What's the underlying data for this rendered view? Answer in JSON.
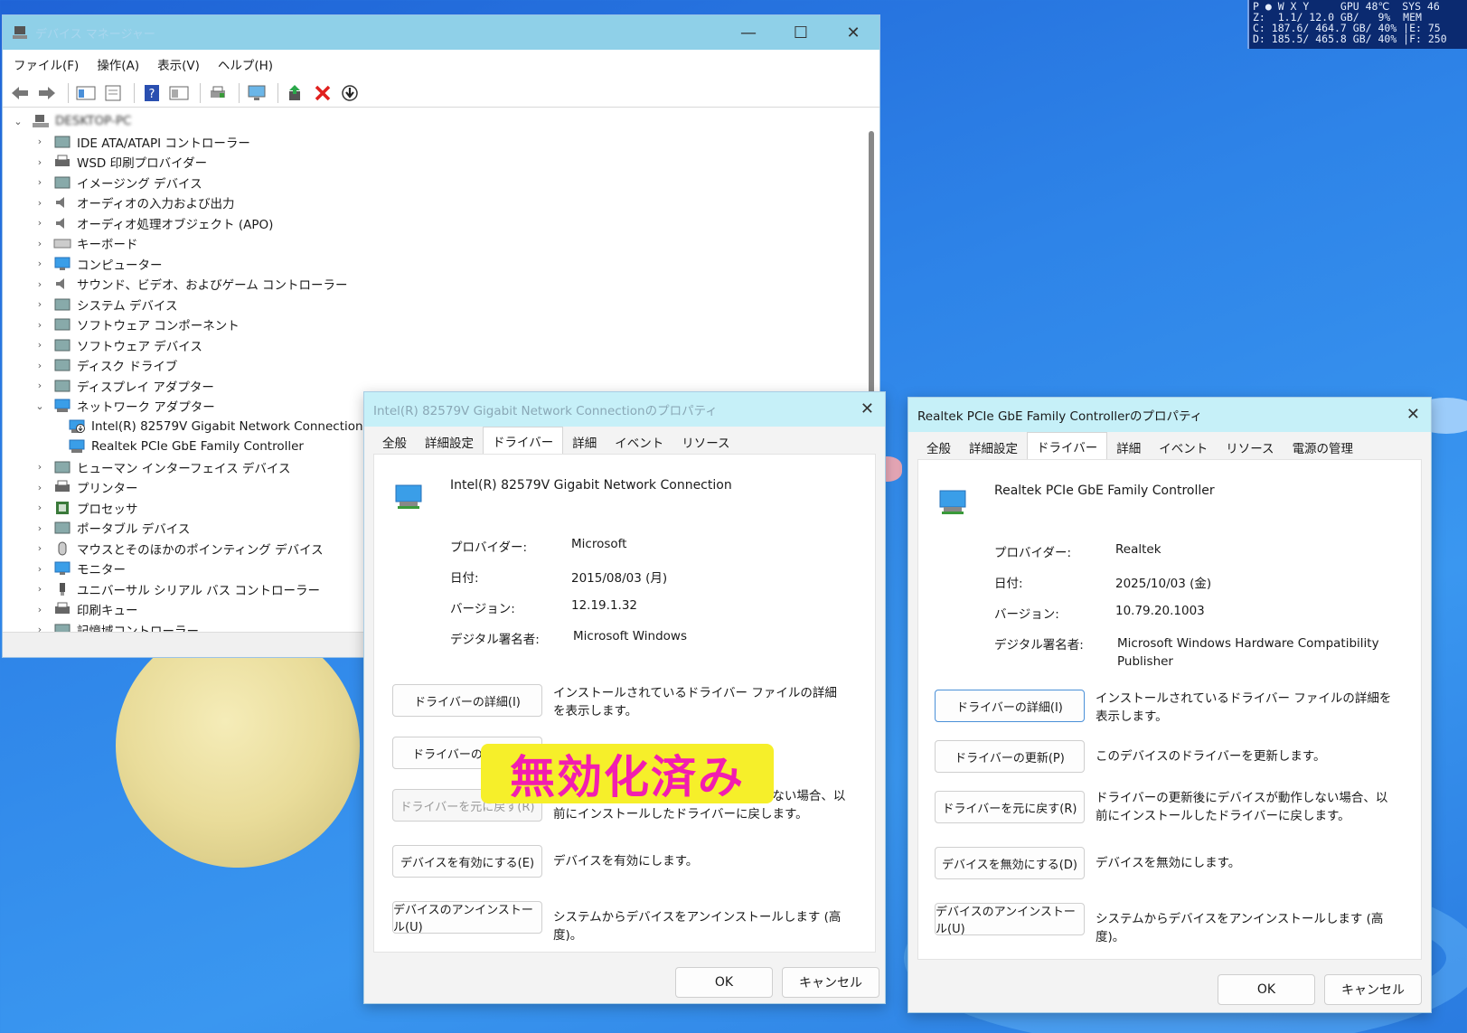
{
  "sysmon": {
    "line1": "P ● W X Y     GPU 48℃  SYS 46",
    "line2": "Z:  1.1/ 12.0 GB/   9%  MEM",
    "line3": "C: 187.6/ 464.7 GB/ 40% |E: 75",
    "line4": "D: 185.5/ 465.8 GB/ 40% |F: 250"
  },
  "device_manager": {
    "title": "デバイス マネージャー",
    "menu": [
      "ファイル(F)",
      "操作(A)",
      "表示(V)",
      "ヘルプ(H)"
    ],
    "root_label": "DESKTOP-PC",
    "categories": [
      {
        "label": "IDE ATA/ATAPI コントローラー",
        "icon": "ide-controller-icon"
      },
      {
        "label": "WSD 印刷プロバイダー",
        "icon": "printer-icon"
      },
      {
        "label": "イメージング デバイス",
        "icon": "camera-icon"
      },
      {
        "label": "オーディオの入力および出力",
        "icon": "speaker-icon"
      },
      {
        "label": "オーディオ処理オブジェクト (APO)",
        "icon": "speaker-icon"
      },
      {
        "label": "キーボード",
        "icon": "keyboard-icon"
      },
      {
        "label": "コンピューター",
        "icon": "monitor-icon"
      },
      {
        "label": "サウンド、ビデオ、およびゲーム コントローラー",
        "icon": "speaker-icon"
      },
      {
        "label": "システム デバイス",
        "icon": "folder-monitor-icon"
      },
      {
        "label": "ソフトウェア コンポーネント",
        "icon": "software-component-icon"
      },
      {
        "label": "ソフトウェア デバイス",
        "icon": "software-device-icon"
      },
      {
        "label": "ディスク ドライブ",
        "icon": "disk-drive-icon"
      },
      {
        "label": "ディスプレイ アダプター",
        "icon": "display-adapter-icon"
      },
      {
        "label": "ネットワーク アダプター",
        "icon": "network-adapter-icon"
      }
    ],
    "network_children": [
      {
        "label": "Intel(R) 82579V Gigabit Network Connection",
        "icon": "network-adapter-disabled-icon"
      },
      {
        "label": "Realtek PCIe GbE Family Controller",
        "icon": "network-adapter-icon"
      }
    ],
    "categories_after": [
      {
        "label": "ヒューマン インターフェイス デバイス",
        "icon": "hid-icon"
      },
      {
        "label": "プリンター",
        "icon": "printer-icon"
      },
      {
        "label": "プロセッサ",
        "icon": "processor-icon"
      },
      {
        "label": "ポータブル デバイス",
        "icon": "portable-device-icon"
      },
      {
        "label": "マウスとそのほかのポインティング デバイス",
        "icon": "mouse-icon"
      },
      {
        "label": "モニター",
        "icon": "monitor-icon"
      },
      {
        "label": "ユニバーサル シリアル バス コントローラー",
        "icon": "usb-icon"
      },
      {
        "label": "印刷キュー",
        "icon": "printer-icon"
      },
      {
        "label": "記憶域コントローラー",
        "icon": "storage-controller-icon"
      }
    ]
  },
  "intel_dialog": {
    "title": "Intel(R) 82579V Gigabit Network Connectionのプロパティ",
    "tabs": [
      "全般",
      "詳細設定",
      "ドライバー",
      "詳細",
      "イベント",
      "リソース"
    ],
    "device_name": "Intel(R) 82579V Gigabit Network Connection",
    "provider_label": "プロバイダー:",
    "provider": "Microsoft",
    "date_label": "日付:",
    "date": "2015/08/03 (月)",
    "version_label": "バージョン:",
    "version": "12.19.1.32",
    "signer_label": "デジタル署名者:",
    "signer": "Microsoft Windows",
    "btn_details": "ドライバーの詳細(I)",
    "desc_details": "インストールされているドライバー ファイルの詳細を表示します。",
    "btn_update": "ドライバーの更新(P)",
    "btn_rollback": "ドライバーを元に戻す(R)",
    "desc_rollback": "ドライバーの更新後にデバイスが動作しない場合、以前にインストールしたドライバーに戻します。",
    "btn_enable": "デバイスを有効にする(E)",
    "desc_enable": "デバイスを有効にします。",
    "btn_uninstall": "デバイスのアンインストール(U)",
    "desc_uninstall": "システムからデバイスをアンインストールします (高度)。",
    "ok": "OK",
    "cancel": "キャンセル"
  },
  "stamp_text": "無効化済み",
  "realtek_dialog": {
    "title": "Realtek PCIe GbE Family Controllerのプロパティ",
    "tabs": [
      "全般",
      "詳細設定",
      "ドライバー",
      "詳細",
      "イベント",
      "リソース",
      "電源の管理"
    ],
    "device_name": "Realtek PCIe GbE Family Controller",
    "provider_label": "プロバイダー:",
    "provider": "Realtek",
    "date_label": "日付:",
    "date": "2025/10/03 (金)",
    "version_label": "バージョン:",
    "version": "10.79.20.1003",
    "signer_label": "デジタル署名者:",
    "signer": "Microsoft Windows Hardware Compatibility Publisher",
    "btn_details": "ドライバーの詳細(I)",
    "desc_details": "インストールされているドライバー ファイルの詳細を表示します。",
    "btn_update": "ドライバーの更新(P)",
    "desc_update": "このデバイスのドライバーを更新します。",
    "btn_rollback": "ドライバーを元に戻す(R)",
    "desc_rollback": "ドライバーの更新後にデバイスが動作しない場合、以前にインストールしたドライバーに戻します。",
    "btn_disable": "デバイスを無効にする(D)",
    "desc_disable": "デバイスを無効にします。",
    "btn_uninstall": "デバイスのアンインストール(U)",
    "desc_uninstall": "システムからデバイスをアンインストールします (高度)。",
    "ok": "OK",
    "cancel": "キャンセル"
  }
}
